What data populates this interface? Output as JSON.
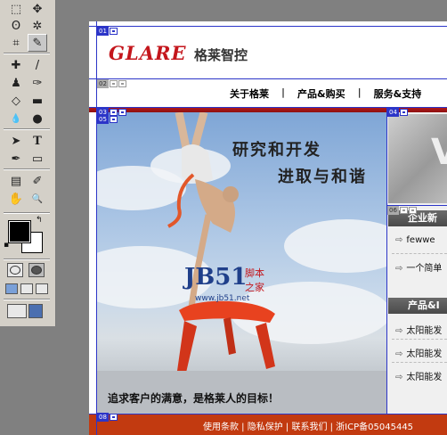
{
  "toolbox": {
    "tools": [
      {
        "name": "marquee-tool",
        "glyph": "⬚"
      },
      {
        "name": "move-tool",
        "glyph": "✥"
      },
      {
        "name": "lasso-tool",
        "glyph": "ʘ"
      },
      {
        "name": "magic-wand-tool",
        "glyph": "✲"
      },
      {
        "name": "crop-tool",
        "glyph": "⌗"
      },
      {
        "name": "slice-tool",
        "glyph": "✎"
      },
      {
        "name": "healing-brush-tool",
        "glyph": "✚"
      },
      {
        "name": "brush-tool",
        "glyph": "/"
      },
      {
        "name": "clone-stamp-tool",
        "glyph": "♟"
      },
      {
        "name": "history-brush-tool",
        "glyph": "✑"
      },
      {
        "name": "eraser-tool",
        "glyph": "◇"
      },
      {
        "name": "gradient-tool",
        "glyph": "▬"
      },
      {
        "name": "blur-tool",
        "glyph": "💧"
      },
      {
        "name": "dodge-tool",
        "glyph": "●"
      },
      {
        "name": "path-selection-tool",
        "glyph": "➤"
      },
      {
        "name": "type-tool",
        "glyph": "T"
      },
      {
        "name": "pen-tool",
        "glyph": "✒"
      },
      {
        "name": "shape-tool",
        "glyph": "▭"
      },
      {
        "name": "notes-tool",
        "glyph": "▤"
      },
      {
        "name": "eyedropper-tool",
        "glyph": "✐"
      },
      {
        "name": "hand-tool",
        "glyph": "✋"
      },
      {
        "name": "zoom-tool",
        "glyph": "🔍"
      }
    ],
    "colors": {
      "foreground": "#000000",
      "background": "#ffffff"
    }
  },
  "slices": {
    "s01": "01",
    "s02": "02",
    "s03": "03",
    "s04": "04",
    "s05": "05",
    "s06": "06",
    "s08": "08"
  },
  "header": {
    "logo_en": "GLARE",
    "logo_cn": "格莱智控"
  },
  "nav": {
    "items": [
      "关于格莱",
      "产品&购买",
      "服务&支持"
    ]
  },
  "hero": {
    "line1": "研究和开发",
    "line2": "进取与和谐",
    "caption": "追求客户的满意，是格莱人的目标！"
  },
  "watermark": {
    "logo": "JB51",
    "text_a": "脚本",
    "text_b": "之家",
    "url": "www.jb51.net"
  },
  "sidebar": {
    "image_letter": "V",
    "news_heading": "企业新",
    "news_items": [
      "fewwe",
      "一个简单"
    ],
    "product_heading": "产品&Ⅰ",
    "product_items": [
      "太阳能发",
      "太阳能发",
      "太阳能发"
    ]
  },
  "footer": {
    "text": "使用条款 | 隐私保护 | 联系我们 | 浙ICP备05045445"
  },
  "accent_colors": {
    "brand_red": "#c4161c",
    "slice_blue": "#2c35c8",
    "footer": "#c23a10"
  }
}
